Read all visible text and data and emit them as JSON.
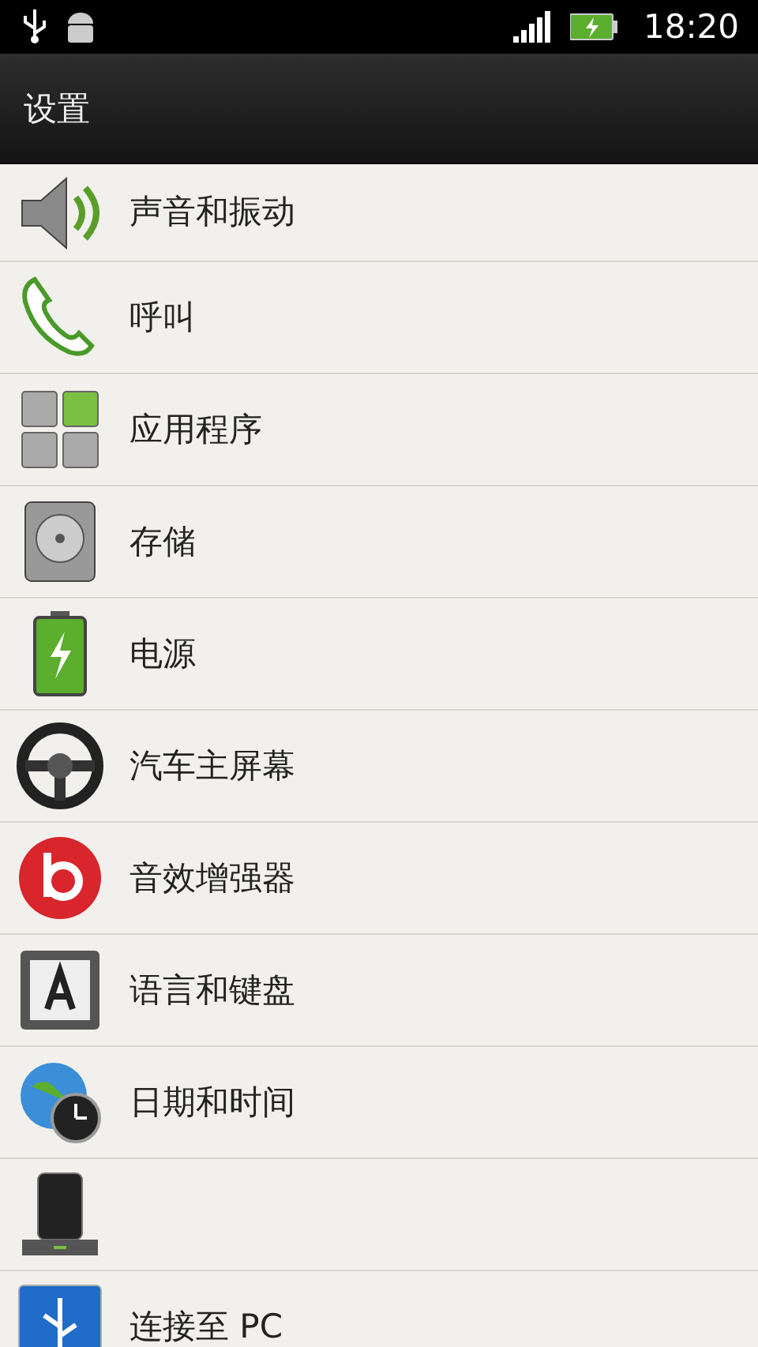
{
  "status_bar": {
    "time": "18:20"
  },
  "title_bar": {
    "title": "设置"
  },
  "settings": [
    {
      "kind": "sound",
      "label": "声音和振动"
    },
    {
      "kind": "call",
      "label": "呼叫"
    },
    {
      "kind": "apps",
      "label": "应用程序"
    },
    {
      "kind": "storage",
      "label": "存储"
    },
    {
      "kind": "power",
      "label": "电源"
    },
    {
      "kind": "car",
      "label": "汽车主屏幕"
    },
    {
      "kind": "beats",
      "label": "音效增强器"
    },
    {
      "kind": "keyboard",
      "label": "语言和键盘"
    },
    {
      "kind": "clock",
      "label": "日期和时间"
    },
    {
      "kind": "dock"
    },
    {
      "kind": "usb",
      "label": "连接至 PC"
    }
  ]
}
